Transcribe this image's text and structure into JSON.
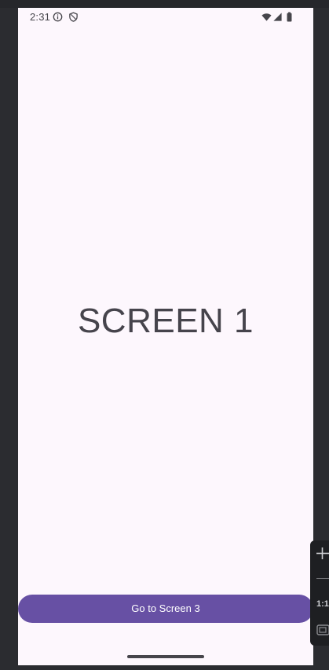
{
  "status_bar": {
    "time": "2:31",
    "icons": [
      "info-icon",
      "shield-icon",
      "wifi-icon",
      "signal-icon",
      "battery-icon"
    ]
  },
  "screen": {
    "title": "SCREEN 1"
  },
  "actions": {
    "primary_label": "Go to Screen 3"
  },
  "emulator_toolbar": {
    "ratio_label": "1:1",
    "icons": [
      "zoom-in-icon",
      "screenshot-icon"
    ]
  },
  "colors": {
    "background": "#fdf7fd",
    "button": "#6750a4",
    "button_text": "#ffffff",
    "title_text": "#46444c"
  }
}
